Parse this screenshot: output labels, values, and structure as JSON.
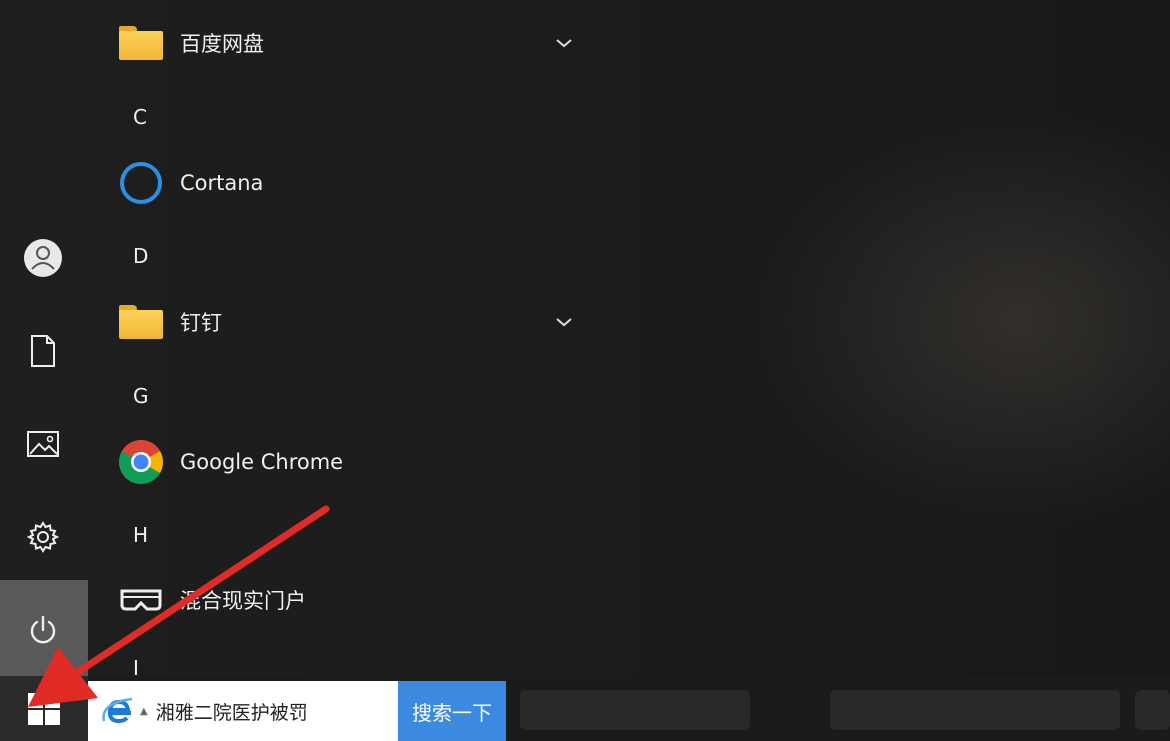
{
  "start_menu": {
    "rail": {
      "icons": [
        "user-avatar-icon",
        "document-icon",
        "pictures-icon",
        "settings-gear-icon",
        "power-icon"
      ]
    },
    "apps": [
      {
        "type": "folder",
        "label": "百度网盘",
        "expandable": true
      },
      {
        "type": "letter",
        "label": "C"
      },
      {
        "type": "app",
        "label": "Cortana",
        "icon": "cortana-ring-icon"
      },
      {
        "type": "letter",
        "label": "D"
      },
      {
        "type": "folder",
        "label": "钉钉",
        "expandable": true
      },
      {
        "type": "letter",
        "label": "G"
      },
      {
        "type": "app",
        "label": "Google Chrome",
        "icon": "chrome-icon"
      },
      {
        "type": "letter",
        "label": "H"
      },
      {
        "type": "app",
        "label": "混合现实门户",
        "icon": "vr-headset-icon"
      },
      {
        "type": "letter",
        "label": "I"
      }
    ]
  },
  "taskbar": {
    "start_icon": "windows-logo-icon",
    "search": {
      "engine_icon": "ie-icon",
      "query": "湘雅二院医护被罚",
      "button_label": "搜索一下"
    }
  },
  "annotation": {
    "arrow_color": "#e02b27"
  },
  "colors": {
    "accent": "#3c89e0",
    "folder": "#f6c043",
    "chrome_red": "#db4437"
  }
}
